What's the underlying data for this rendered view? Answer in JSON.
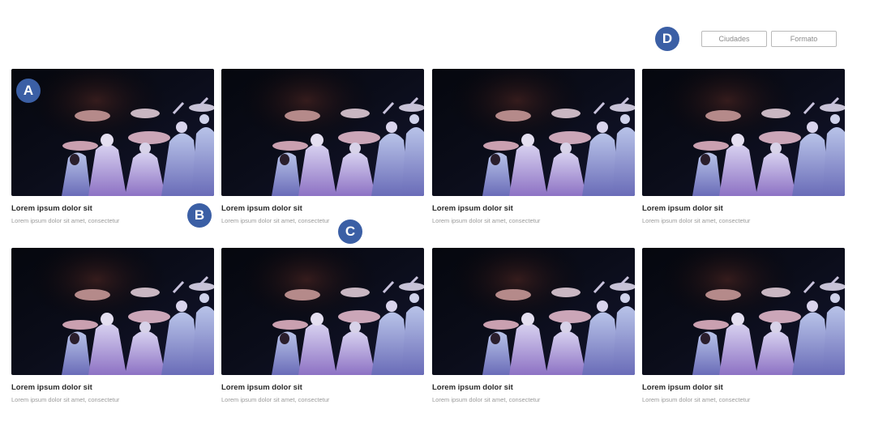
{
  "filters": {
    "ciudades_label": "Ciudades",
    "formato_label": "Formato"
  },
  "cards": [
    {
      "title": "Lorem ipsum dolor sit",
      "description": "Lorem ipsum dolor sit amet, consectetur"
    },
    {
      "title": "Lorem ipsum dolor sit",
      "description": "Lorem ipsum dolor sit amet, consectetur"
    },
    {
      "title": "Lorem ipsum dolor sit",
      "description": "Lorem ipsum dolor sit amet, consectetur"
    },
    {
      "title": "Lorem ipsum dolor sit",
      "description": "Lorem ipsum dolor sit amet, consectetur"
    },
    {
      "title": "Lorem ipsum dolor sit",
      "description": "Lorem ipsum dolor sit amet, consectetur"
    },
    {
      "title": "Lorem ipsum dolor sit",
      "description": "Lorem ipsum dolor sit amet, consectetur"
    },
    {
      "title": "Lorem ipsum dolor sit",
      "description": "Lorem ipsum dolor sit amet, consectetur"
    },
    {
      "title": "Lorem ipsum dolor sit",
      "description": "Lorem ipsum dolor sit amet, consectetur"
    }
  ],
  "markers": {
    "a": "A",
    "b": "B",
    "c": "C",
    "d": "D"
  },
  "colors": {
    "marker": "#3b5fa5",
    "button_border": "#b9b9b9",
    "title_text": "#2a2a2a",
    "desc_text": "#9a9a9a"
  },
  "photo_description": "dark stage photo of performers in white robes carrying baskets on their heads"
}
